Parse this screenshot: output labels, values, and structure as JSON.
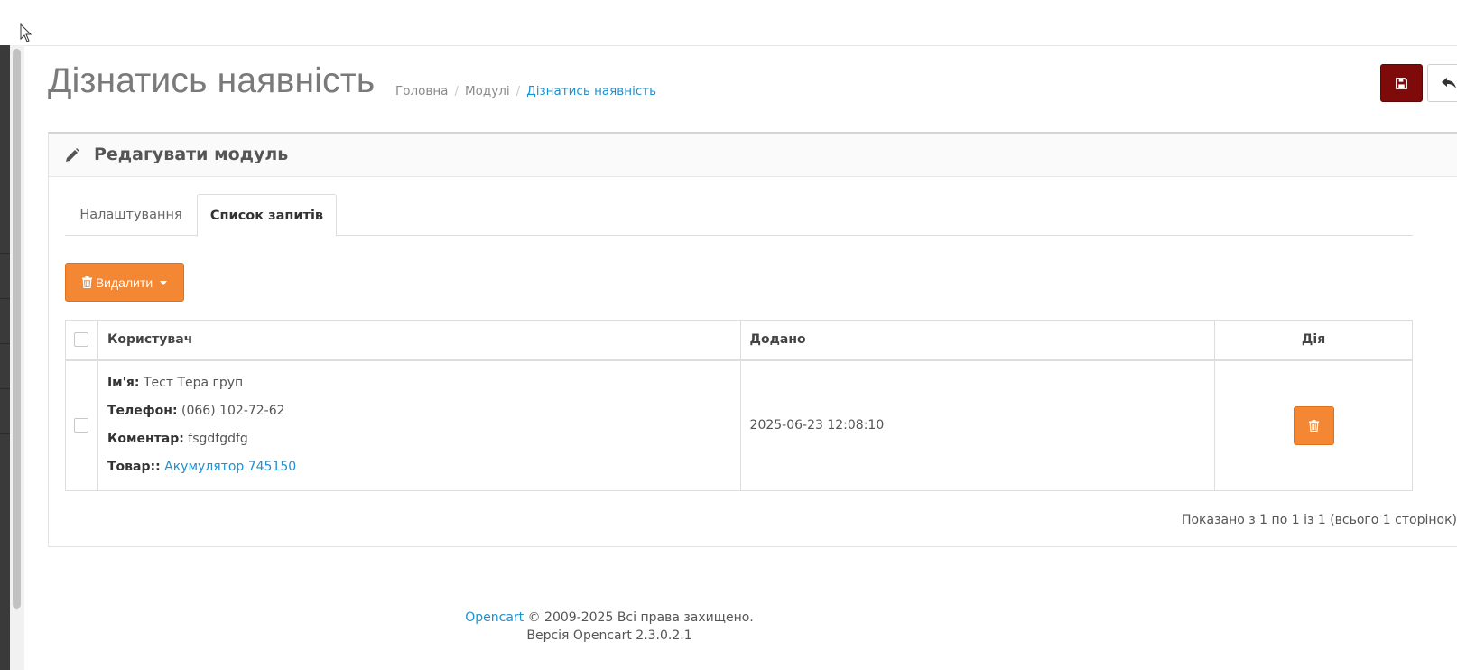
{
  "page": {
    "title": "Дізнатись наявність",
    "breadcrumb": [
      "Головна",
      "Модулі",
      "Дізнатись наявність"
    ],
    "breadcrumb_separator": "/"
  },
  "actions": {
    "save_icon": "save-icon",
    "back_icon": "reply-icon"
  },
  "panel": {
    "title": "Редагувати модуль",
    "icon": "pencil-icon"
  },
  "tabs": [
    {
      "label": "Налаштування",
      "active": false
    },
    {
      "label": "Список запитів",
      "active": true
    }
  ],
  "delete_dropdown": {
    "label": "Видалити"
  },
  "table": {
    "headers": {
      "user": "Користувач",
      "added": "Додано",
      "action": "Дія"
    },
    "rows": [
      {
        "name_label": "Ім'я:",
        "name": "Тест Тера груп",
        "phone_label": "Телефон:",
        "phone": "(066) 102-72-62",
        "comment_label": "Коментар:",
        "comment": "fsgdfgdfg",
        "product_label": "Товар::",
        "product": "Акумулятор 745150",
        "added": "2025-06-23 12:08:10"
      }
    ]
  },
  "pagination": {
    "info": "Показано з 1 по 1 із 1 (всього 1 сторінок)"
  },
  "footer": {
    "brand": "Opencart",
    "copyright": "© 2009-2025 Всі права захищено.",
    "version": "Версія Opencart 2.3.0.2.1"
  },
  "colors": {
    "save_button": "#7f0a0a",
    "warning_button": "#f38733",
    "link": "#1e91cf"
  }
}
